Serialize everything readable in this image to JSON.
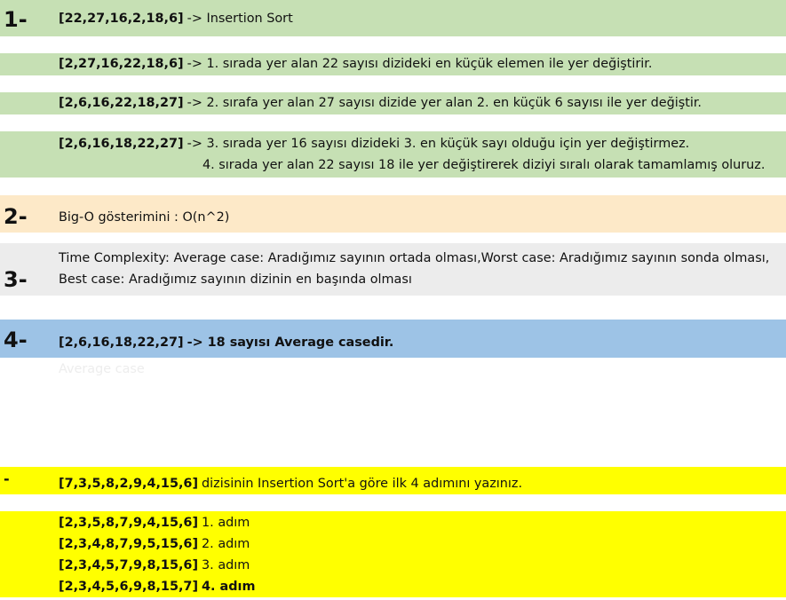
{
  "section1": {
    "number": "1-",
    "rows": [
      {
        "array": "[22,27,16,2,18,6]",
        "text": "-> Insertion Sort"
      },
      {
        "array": "[2,27,16,22,18,6]",
        "text": "-> 1. sırada  yer alan 22 sayısı dizideki en küçük elemen ile yer değiştirir."
      },
      {
        "array": "[2,6,16,22,18,27]",
        "text": "-> 2. sırafa yer alan 27 sayısı dizide yer alan 2. en küçük 6 sayısı ile yer değiştir."
      },
      {
        "array": "[2,6,16,18,22,27]",
        "text": "->  3. sırada yer 16 sayısı dizideki 3. en küçük sayı olduğu için yer değiştirmez."
      }
    ],
    "continuation": "4. sırada yer alan 22 sayısı 18 ile yer değiştirerek diziyi sıralı olarak tamamlamış oluruz."
  },
  "section2": {
    "number": "2-",
    "text": "Big-O gösterimini :  O(n^2)"
  },
  "section3": {
    "number": "3-",
    "line1": "Time Complexity: Average case: Aradığımız sayının ortada olması,Worst case: Aradığımız sayının sonda olması,",
    "line2": "Best case: Aradığımız sayının dizinin en başında olması"
  },
  "section4": {
    "number": "4-",
    "array": "[2,6,16,18,22,27]",
    "text": "-> 18 sayısı  Average casedir.",
    "faint_text": "Average case"
  },
  "section5": {
    "number": "-",
    "array": "[7,3,5,8,2,9,4,15,6]",
    "text": "dizisinin Insertion Sort'a göre ilk 4 adımını yazınız.",
    "steps": [
      {
        "array": "[2,3,5,8,7,9,4,15,6]",
        "label": "1. adım"
      },
      {
        "array": "[2,3,4,8,7,9,5,15,6]",
        "label": "2. adım"
      },
      {
        "array": "[2,3,4,5,7,9,8,15,6]",
        "label": "3. adım"
      },
      {
        "array": "[2,3,4,5,6,9,8,15,7]",
        "label": "4. adım"
      }
    ]
  },
  "colors": {
    "green": "#c6e0b4",
    "peach": "#fde9c8",
    "gray": "#ececec",
    "blue": "#9dc3e6",
    "yellow": "#ffff00"
  }
}
